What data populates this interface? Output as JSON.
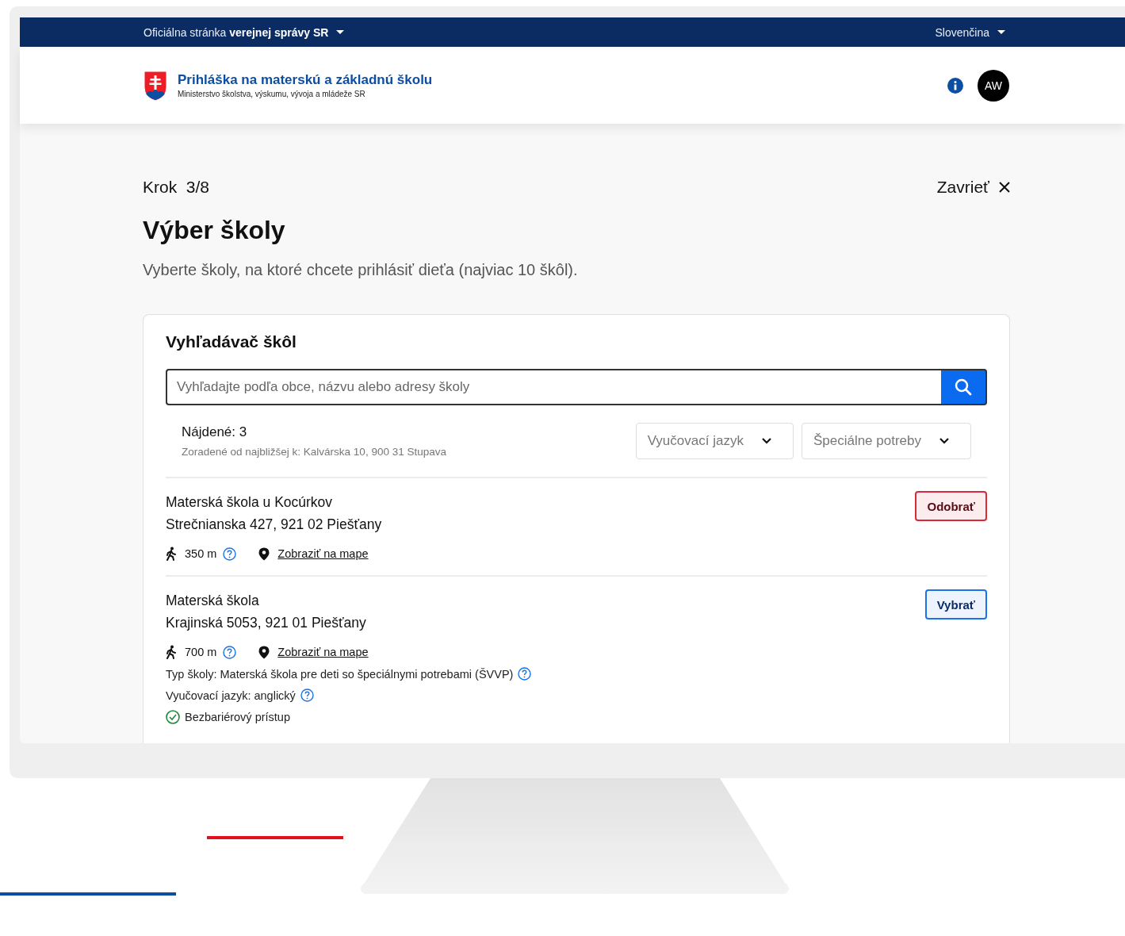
{
  "top_bar": {
    "official_text": "Oficiálna stránka **verejnej správy SR**",
    "language": "Slovenčina"
  },
  "header": {
    "title": "Prihláška na materskú a základnú školu",
    "subtitle": "Ministerstvo školstva, výskumu, vývoja a mládeže SR",
    "avatar_initials": "AW"
  },
  "step": {
    "label": "Krok  3/8",
    "close": "Zavrieť"
  },
  "page": {
    "heading": "Výber školy",
    "intro": "Vyberte školy, na ktoré chcete prihlásiť dieťa (najviac 10 škôl)."
  },
  "search_panel": {
    "title": "Vyhľadávač škôl",
    "search": {
      "placeholder": "Vyhľadajte podľa obce, názvu alebo adresy školy"
    },
    "found": "Nájdené: 3",
    "sorted": "Zoradené od najbližšej k: Kalvárska 10,  900 31 Stupava",
    "filters": [
      {
        "placeholder": "Vyučovací jazyk"
      },
      {
        "placeholder": "Špeciálne potreby"
      }
    ]
  },
  "schools": [
    {
      "name": "Materská škola u Kocúrkov",
      "address": "Strečnianska 427, 921 02 Piešťany",
      "distance": "350 m",
      "map_link": "Zobraziť na mape",
      "selected": true,
      "action": "Odobrať"
    },
    {
      "name": "Materská škola",
      "address": "Krajinská 5053, 921 01 Piešťany",
      "distance": "700 m",
      "map_link": "Zobraziť na mape",
      "selected": false,
      "action": "Vybrať",
      "details": [
        {
          "text": "Typ školy: Materská škola pre deti so špeciálnymi potrebami (ŠVVP)"
        },
        {
          "text": "Vyučovací jazyk: anglický"
        }
      ],
      "features": [
        {
          "text": "Bezbariérový prístup"
        }
      ]
    }
  ]
}
